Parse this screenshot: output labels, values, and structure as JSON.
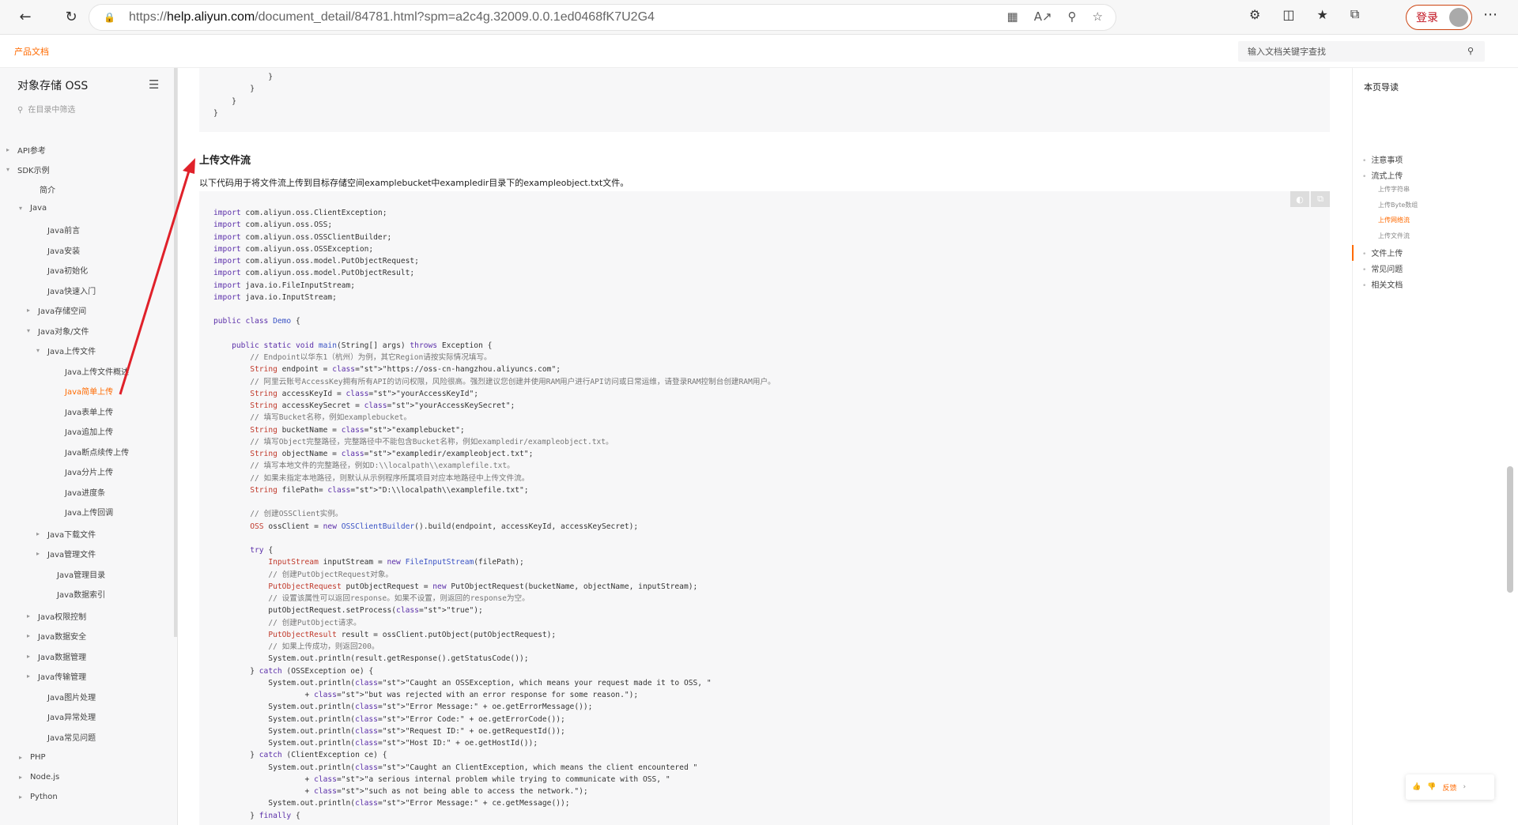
{
  "browser": {
    "url_prefix": "https://",
    "url_host": "help.aliyun.com",
    "url_path": "/document_detail/84781.html?spm=a2c4g.32009.0.0.1ed0468fK7U2G4",
    "login_label": "登录"
  },
  "site": {
    "brand": "产品文档",
    "search_placeholder": "输入文档关键字查找"
  },
  "sidebar": {
    "title": "对象存储 OSS",
    "filter_placeholder": "在目录中筛选",
    "items": [
      {
        "label": "API参考",
        "arrow": "▸"
      },
      {
        "label": "SDK示例",
        "arrow": "▾"
      },
      {
        "label": "简介",
        "arrow": ""
      },
      {
        "label": "Java",
        "arrow": "▾"
      },
      {
        "label": "Java前言",
        "arrow": ""
      },
      {
        "label": "Java安装",
        "arrow": ""
      },
      {
        "label": "Java初始化",
        "arrow": ""
      },
      {
        "label": "Java快速入门",
        "arrow": ""
      },
      {
        "label": "Java存储空间",
        "arrow": "▸"
      },
      {
        "label": "Java对象/文件",
        "arrow": "▾"
      },
      {
        "label": "Java上传文件",
        "arrow": "▾"
      },
      {
        "label": "Java上传文件概述",
        "arrow": ""
      },
      {
        "label": "Java简单上传",
        "arrow": ""
      },
      {
        "label": "Java表单上传",
        "arrow": ""
      },
      {
        "label": "Java追加上传",
        "arrow": ""
      },
      {
        "label": "Java断点续传上传",
        "arrow": ""
      },
      {
        "label": "Java分片上传",
        "arrow": ""
      },
      {
        "label": "Java进度条",
        "arrow": ""
      },
      {
        "label": "Java上传回调",
        "arrow": ""
      },
      {
        "label": "Java下载文件",
        "arrow": "▸"
      },
      {
        "label": "Java管理文件",
        "arrow": "▸"
      },
      {
        "label": "Java管理目录",
        "arrow": ""
      },
      {
        "label": "Java数据索引",
        "arrow": ""
      },
      {
        "label": "Java权限控制",
        "arrow": "▸"
      },
      {
        "label": "Java数据安全",
        "arrow": "▸"
      },
      {
        "label": "Java数据管理",
        "arrow": "▸"
      },
      {
        "label": "Java传输管理",
        "arrow": "▸"
      },
      {
        "label": "Java图片处理",
        "arrow": ""
      },
      {
        "label": "Java异常处理",
        "arrow": ""
      },
      {
        "label": "Java常见问题",
        "arrow": ""
      },
      {
        "label": "PHP",
        "arrow": "▸"
      },
      {
        "label": "Node.js",
        "arrow": "▸"
      },
      {
        "label": "Python",
        "arrow": "▸"
      }
    ]
  },
  "content": {
    "top_code": [
      "            }",
      "        }",
      "    }",
      "}"
    ],
    "section_title": "上传文件流",
    "section_desc": "以下代码用于将文件流上传到目标存储空间examplebucket中exampledir目录下的exampleobject.txt文件。",
    "code": [
      "import com.aliyun.oss.ClientException;",
      "import com.aliyun.oss.OSS;",
      "import com.aliyun.oss.OSSClientBuilder;",
      "import com.aliyun.oss.OSSException;",
      "import com.aliyun.oss.model.PutObjectRequest;",
      "import com.aliyun.oss.model.PutObjectResult;",
      "import java.io.FileInputStream;",
      "import java.io.InputStream;",
      "",
      "public class Demo {",
      "",
      "    public static void main(String[] args) throws Exception {",
      "        // Endpoint以华东1（杭州）为例，其它Region请按实际情况填写。",
      "        String endpoint = \"https://oss-cn-hangzhou.aliyuncs.com\";",
      "        // 阿里云账号AccessKey拥有所有API的访问权限，风险很高。强烈建议您创建并使用RAM用户进行API访问或日常运维，请登录RAM控制台创建RAM用户。",
      "        String accessKeyId = \"yourAccessKeyId\";",
      "        String accessKeySecret = \"yourAccessKeySecret\";",
      "        // 填写Bucket名称，例如examplebucket。",
      "        String bucketName = \"examplebucket\";",
      "        // 填写Object完整路径，完整路径中不能包含Bucket名称，例如exampledir/exampleobject.txt。",
      "        String objectName = \"exampledir/exampleobject.txt\";",
      "        // 填写本地文件的完整路径，例如D:\\\\localpath\\\\examplefile.txt。",
      "        // 如果未指定本地路径，则默认从示例程序所属项目对应本地路径中上传文件流。",
      "        String filePath= \"D:\\\\localpath\\\\examplefile.txt\";",
      "",
      "        // 创建OSSClient实例。",
      "        OSS ossClient = new OSSClientBuilder().build(endpoint, accessKeyId, accessKeySecret);",
      "",
      "        try {",
      "            InputStream inputStream = new FileInputStream(filePath);",
      "            // 创建PutObjectRequest对象。",
      "            PutObjectRequest putObjectRequest = new PutObjectRequest(bucketName, objectName, inputStream);",
      "            // 设置该属性可以返回response。如果不设置，则返回的response为空。",
      "            putObjectRequest.setProcess(\"true\");",
      "            // 创建PutObject请求。",
      "            PutObjectResult result = ossClient.putObject(putObjectRequest);",
      "            // 如果上传成功，则返回200。",
      "            System.out.println(result.getResponse().getStatusCode());",
      "        } catch (OSSException oe) {",
      "            System.out.println(\"Caught an OSSException, which means your request made it to OSS, \"",
      "                    + \"but was rejected with an error response for some reason.\");",
      "            System.out.println(\"Error Message:\" + oe.getErrorMessage());",
      "            System.out.println(\"Error Code:\" + oe.getErrorCode());",
      "            System.out.println(\"Request ID:\" + oe.getRequestId());",
      "            System.out.println(\"Host ID:\" + oe.getHostId());",
      "        } catch (ClientException ce) {",
      "            System.out.println(\"Caught an ClientException, which means the client encountered \"",
      "                    + \"a serious internal problem while trying to communicate with OSS, \"",
      "                    + \"such as not being able to access the network.\");",
      "            System.out.println(\"Error Message:\" + ce.getMessage());",
      "        } finally {"
    ]
  },
  "toc": {
    "title": "本页导读",
    "items": [
      {
        "label": "注意事项",
        "level": 1
      },
      {
        "label": "流式上传",
        "level": 1
      },
      {
        "label": "上传字符串",
        "level": 2
      },
      {
        "label": "上传Byte数组",
        "level": 2
      },
      {
        "label": "上传网络流",
        "level": 2
      },
      {
        "label": "上传文件流",
        "level": 2
      },
      {
        "label": "文件上传",
        "level": 1
      },
      {
        "label": "常见问题",
        "level": 1
      },
      {
        "label": "相关文档",
        "level": 1
      }
    ]
  },
  "feedback": {
    "label": "反馈"
  },
  "colors": {
    "accent": "#ff6a00",
    "annotation_arrow": "#e0212a"
  }
}
